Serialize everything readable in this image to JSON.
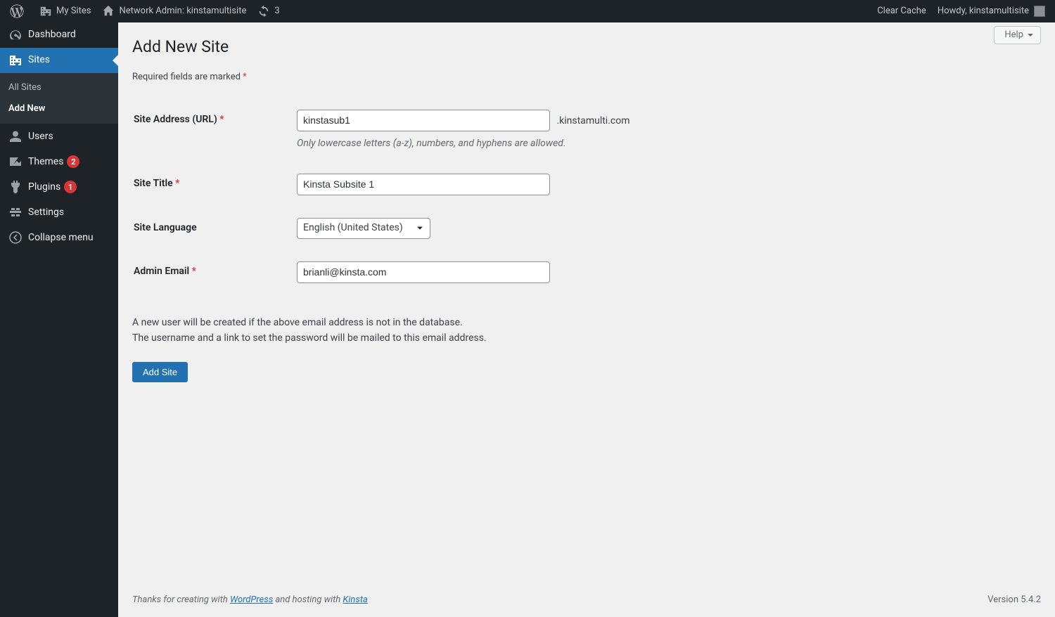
{
  "toolbar": {
    "my_sites": "My Sites",
    "network_admin": "Network Admin: kinstamultisite",
    "updates_count": "3",
    "clear_cache": "Clear Cache",
    "howdy": "Howdy, kinstamultisite"
  },
  "sidebar": {
    "dashboard": "Dashboard",
    "sites": "Sites",
    "sites_sub_all": "All Sites",
    "sites_sub_add": "Add New",
    "users": "Users",
    "themes": "Themes",
    "themes_badge": "2",
    "plugins": "Plugins",
    "plugins_badge": "1",
    "settings": "Settings",
    "collapse": "Collapse menu"
  },
  "page": {
    "title": "Add New Site",
    "help": "Help",
    "required_intro": "Required fields are marked "
  },
  "form": {
    "site_address_label": "Site Address (URL) ",
    "site_address_value": "kinstasub1",
    "domain_suffix": ".kinstamulti.com",
    "site_address_hint": "Only lowercase letters (a-z), numbers, and hyphens are allowed.",
    "site_title_label": "Site Title ",
    "site_title_value": "Kinsta Subsite 1",
    "site_language_label": "Site Language",
    "site_language_value": "English (United States)",
    "admin_email_label": "Admin Email ",
    "admin_email_value": "brianli@kinsta.com",
    "note_line1": "A new user will be created if the above email address is not in the database.",
    "note_line2": "The username and a link to set the password will be mailed to this email address.",
    "submit": "Add Site"
  },
  "footer": {
    "pre": "Thanks for creating with ",
    "wp": "WordPress",
    "mid": " and hosting with ",
    "kinsta": "Kinsta",
    "version": "Version 5.4.2"
  }
}
